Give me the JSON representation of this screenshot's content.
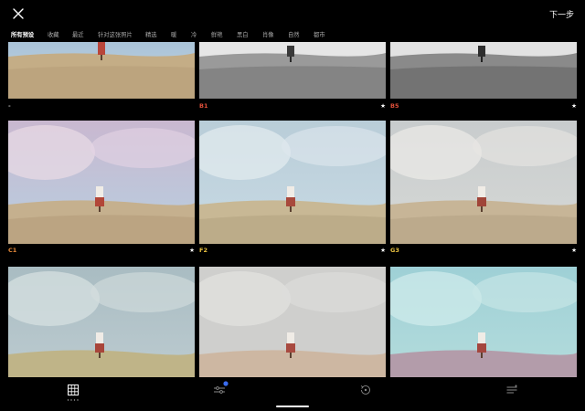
{
  "topbar": {
    "next_label": "下一步",
    "close_icon": "close-icon"
  },
  "tabs": [
    {
      "label": "所有预设",
      "active": true
    },
    {
      "label": "收藏",
      "active": false
    },
    {
      "label": "最近",
      "active": false
    },
    {
      "label": "针对这张照片",
      "active": false
    },
    {
      "label": "精选",
      "active": false
    },
    {
      "label": "暖",
      "active": false
    },
    {
      "label": "冷",
      "active": false
    },
    {
      "label": "鲜艳",
      "active": false
    },
    {
      "label": "黑白",
      "active": false
    },
    {
      "label": "肖像",
      "active": false
    },
    {
      "label": "自然",
      "active": false
    },
    {
      "label": "都市",
      "active": false
    }
  ],
  "presets": [
    {
      "label": "-",
      "starred": false,
      "color": "#c0c0c0"
    },
    {
      "label": "B1",
      "starred": true,
      "color": "#e0503a"
    },
    {
      "label": "B5",
      "starred": true,
      "color": "#e0503a"
    },
    {
      "label": "C1",
      "starred": true,
      "color": "#e88a3a"
    },
    {
      "label": "F2",
      "starred": true,
      "color": "#e8c040"
    },
    {
      "label": "G3",
      "starred": true,
      "color": "#e8c040"
    },
    {
      "label": "",
      "starred": false,
      "color": "#ffffff"
    },
    {
      "label": "",
      "starred": false,
      "color": "#ffffff"
    },
    {
      "label": "",
      "starred": false,
      "color": "#ffffff"
    }
  ],
  "star_glyph": "★",
  "bottombar": {
    "icons": [
      "presets-grid-icon",
      "adjust-sliders-icon",
      "history-icon",
      "recipes-icon"
    ],
    "active": "presets-grid-icon",
    "accent_color": "#3a6cf0"
  }
}
